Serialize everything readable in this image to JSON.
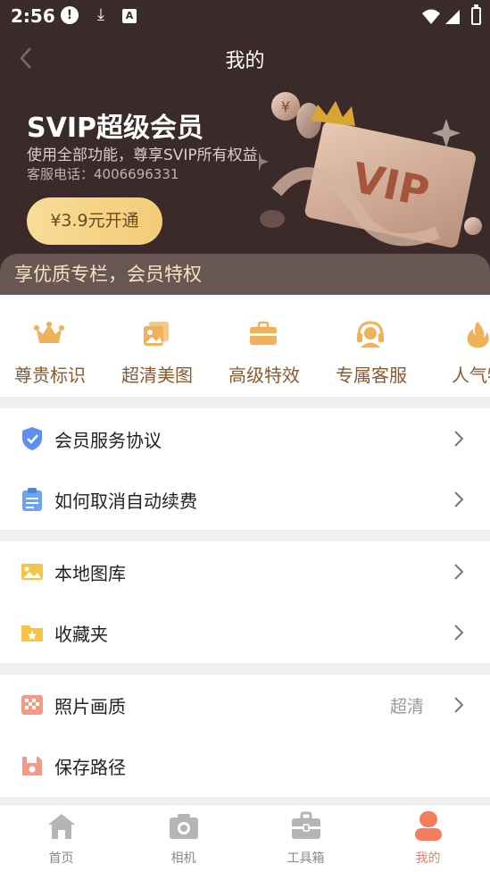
{
  "status_bar": {
    "time": "2:56"
  },
  "header": {
    "title": "我的"
  },
  "vip": {
    "title": "SVIP超级会员",
    "description": "使用全部功能，尊享SVIP所有权益",
    "phone": "客服电话：4006696331",
    "open_button": "¥3.9元开通",
    "card_text": "VIP"
  },
  "banner": {
    "text": "享优质专栏，会员特权"
  },
  "privileges": [
    {
      "label": "尊贵标识",
      "icon": "crown-icon"
    },
    {
      "label": "超清美图",
      "icon": "photo-stack-icon"
    },
    {
      "label": "高级特效",
      "icon": "briefcase-icon"
    },
    {
      "label": "专属客服",
      "icon": "headset-icon"
    },
    {
      "label": "人气特",
      "icon": "flame-icon"
    }
  ],
  "menu": {
    "section1": [
      {
        "label": "会员服务协议",
        "icon": "shield-check-icon"
      },
      {
        "label": "如何取消自动续费",
        "icon": "clipboard-icon"
      }
    ],
    "section2": [
      {
        "label": "本地图库",
        "icon": "image-icon"
      },
      {
        "label": "收藏夹",
        "icon": "star-folder-icon"
      }
    ],
    "section3": [
      {
        "label": "照片画质",
        "value": "超清",
        "icon": "checker-icon"
      },
      {
        "label": "保存路径",
        "icon": "save-icon"
      }
    ]
  },
  "bottom_nav": [
    {
      "label": "首页",
      "icon": "home-icon"
    },
    {
      "label": "相机",
      "icon": "camera-icon"
    },
    {
      "label": "工具箱",
      "icon": "toolbox-icon"
    },
    {
      "label": "我的",
      "icon": "profile-icon",
      "active": true
    }
  ],
  "colors": {
    "header_bg": "#3b2b2b",
    "gold": "#f3cc77",
    "privilege_text": "#8a5a2c",
    "accent": "#f47c5f"
  }
}
